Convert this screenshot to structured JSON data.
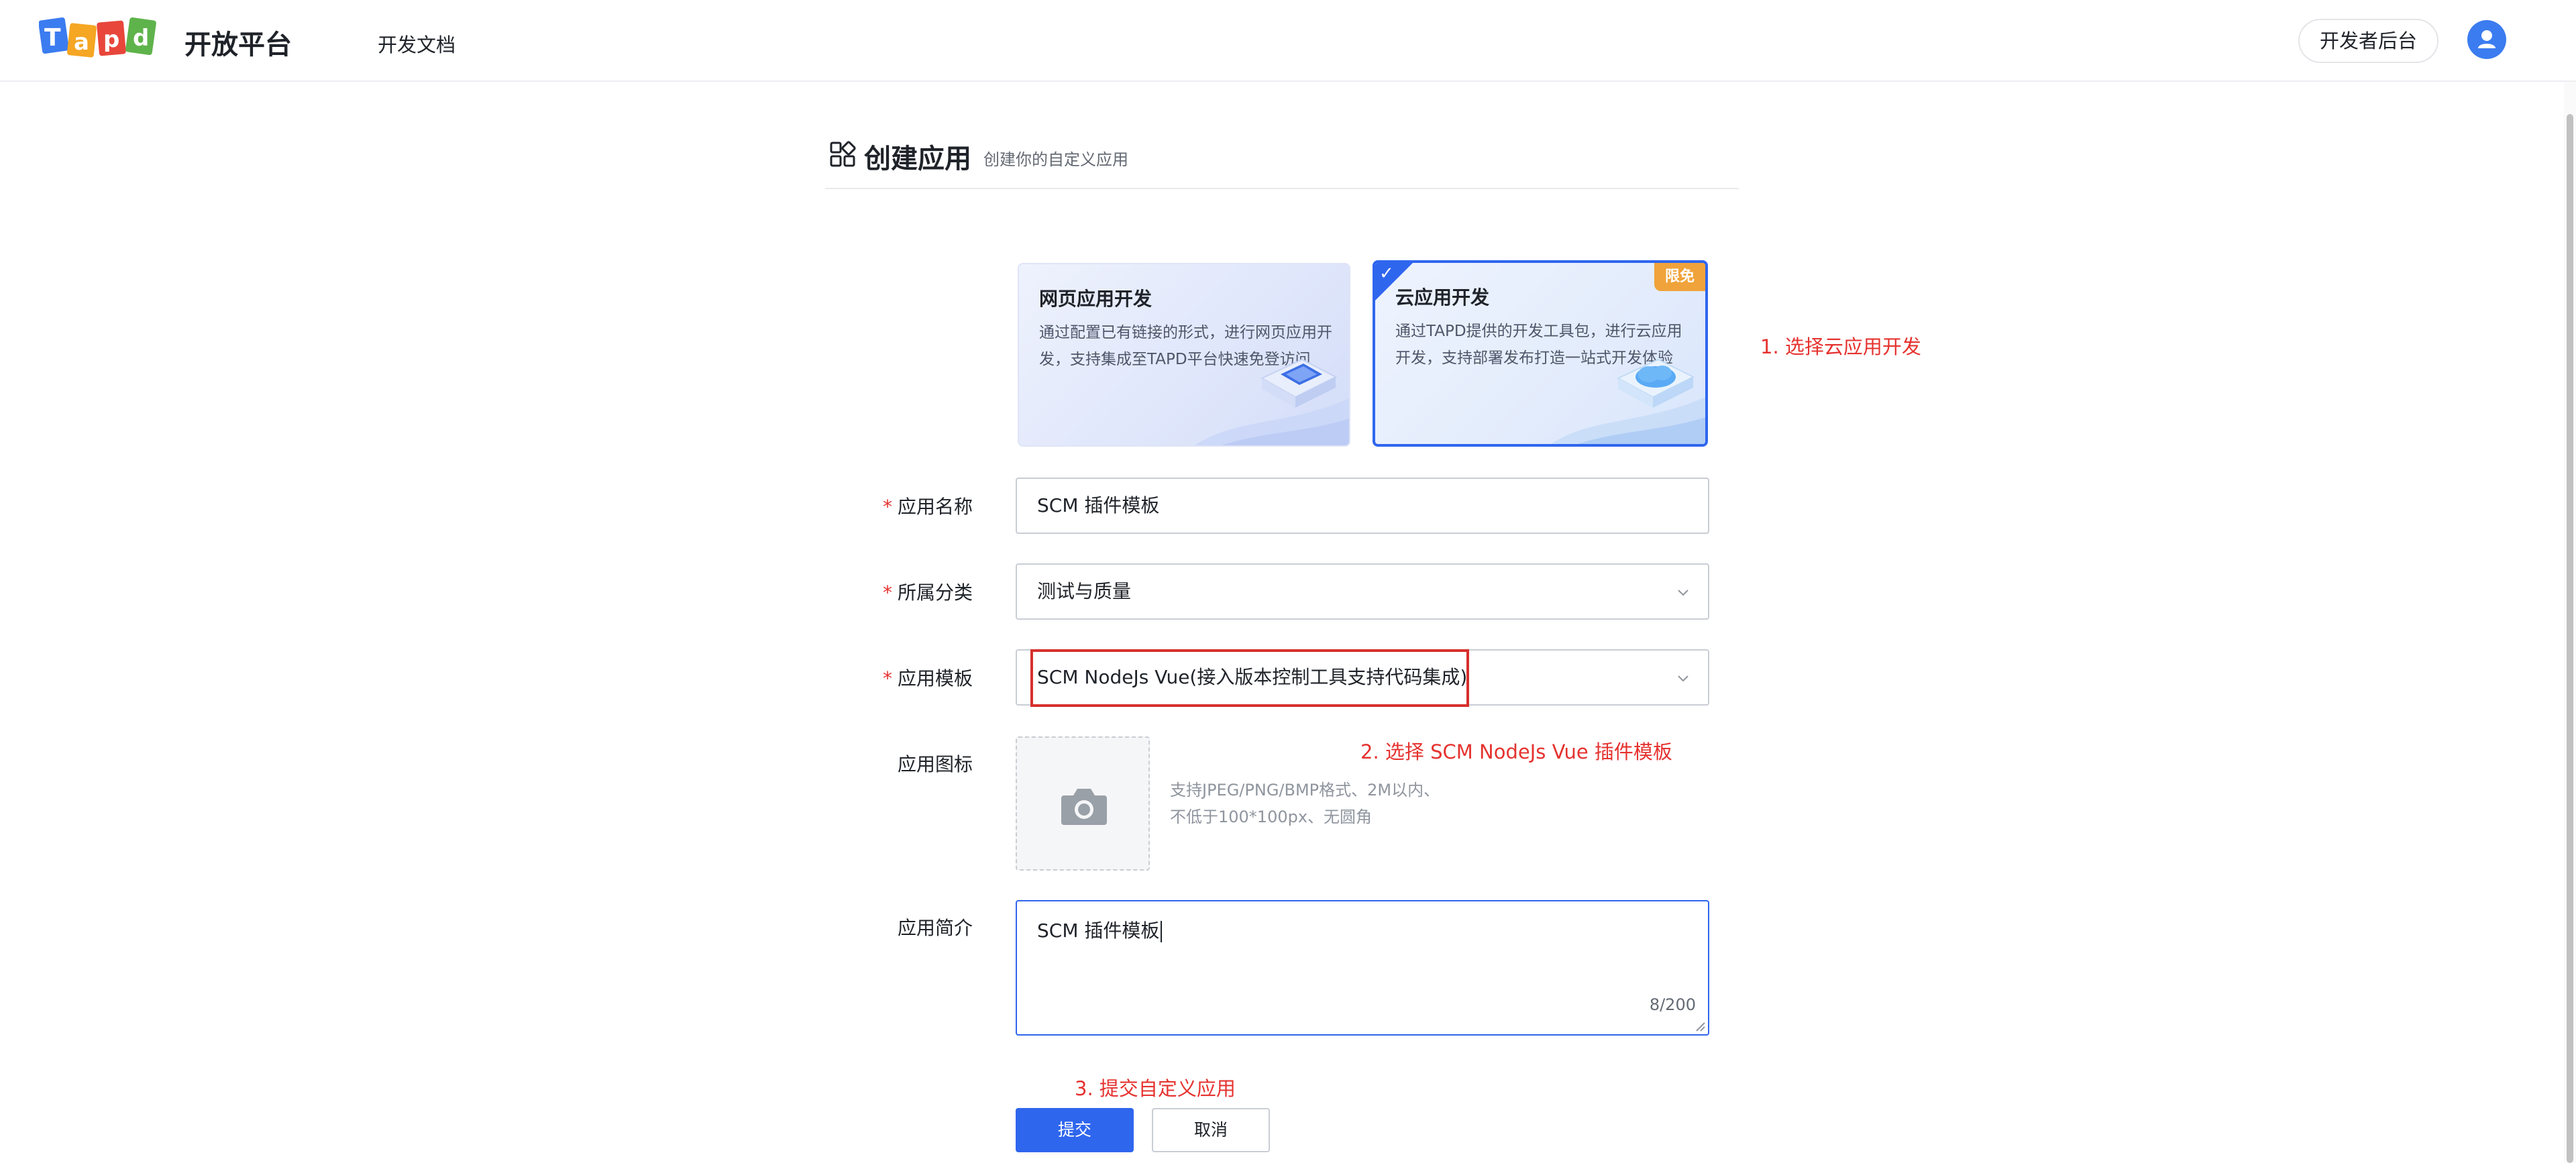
{
  "nav": {
    "brand_title": "开放平台",
    "docs_link": "开发文档",
    "dev_console": "开发者后台",
    "logo_text": "Tapd"
  },
  "header": {
    "title": "创建应用",
    "subtitle": "创建你的自定义应用"
  },
  "cards": {
    "web": {
      "title": "网页应用开发",
      "description": "通过配置已有链接的形式，进行网页应用开发，支持集成至TAPD平台快速免登访问",
      "selected": false
    },
    "cloud": {
      "title": "云应用开发",
      "description": "通过TAPD提供的开发工具包，进行云应用开发，支持部署发布打造一站式开发体验",
      "badge": "限免",
      "check": "✓",
      "selected": true
    }
  },
  "annotations": {
    "step1": "1. 选择云应用开发",
    "step2": "2. 选择 SCM NodeJs Vue 插件模板",
    "step3": "3. 提交自定义应用"
  },
  "form": {
    "required_mark": "*",
    "name": {
      "label": "应用名称",
      "value": "SCM 插件模板"
    },
    "category": {
      "label": "所属分类",
      "value": "测试与质量"
    },
    "template": {
      "label": "应用模板",
      "value": "SCM NodeJs Vue(接入版本控制工具支持代码集成)"
    },
    "icon": {
      "label": "应用图标",
      "hint_line1": "支持JPEG/PNG/BMP格式、2M以内、",
      "hint_line2": "不低于100*100px、无圆角"
    },
    "intro": {
      "label": "应用简介",
      "value": "SCM 插件模板",
      "counter": "8/200"
    },
    "submit": "提交",
    "cancel": "取消"
  },
  "colors": {
    "primary": "#2f66ee",
    "annotation_red": "#e5322f",
    "badge_orange": "#f0a33a"
  },
  "icons": [
    "tapd-logo",
    "apps-grid-icon",
    "user-avatar-icon",
    "camera-icon",
    "chevron-down-icon",
    "check-icon"
  ]
}
